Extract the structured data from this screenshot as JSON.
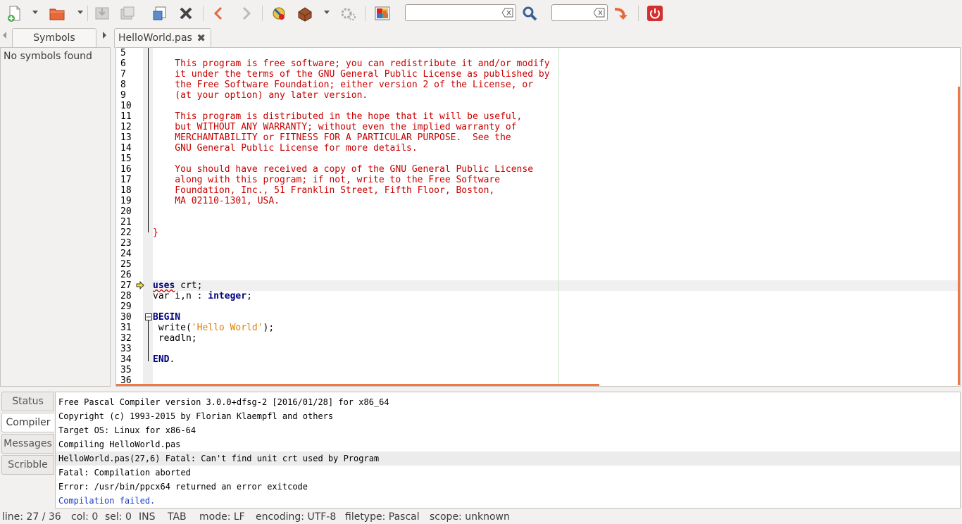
{
  "toolbar": {
    "icons": [
      "new-file-icon",
      "open-file-icon",
      "save-icon",
      "save-all-icon",
      "reload-icon",
      "close-icon",
      "back-icon",
      "forward-icon",
      "compile-icon",
      "build-icon",
      "execute-icon",
      "color-chooser-icon",
      "search-icon",
      "goto-line-icon",
      "quit-icon"
    ]
  },
  "sidebar": {
    "tab_label": "Symbols",
    "empty_text": "No symbols found"
  },
  "editor": {
    "tab_label": "HelloWorld.pas",
    "lines": [
      {
        "n": "5",
        "text": "",
        "cls": "cmt"
      },
      {
        "n": "6",
        "text": "    This program is free software; you can redistribute it and/or modify",
        "cls": "cmt"
      },
      {
        "n": "7",
        "text": "    it under the terms of the GNU General Public License as published by",
        "cls": "cmt"
      },
      {
        "n": "8",
        "text": "    the Free Software Foundation; either version 2 of the License, or",
        "cls": "cmt"
      },
      {
        "n": "9",
        "text": "    (at your option) any later version.",
        "cls": "cmt"
      },
      {
        "n": "10",
        "text": "",
        "cls": "cmt"
      },
      {
        "n": "11",
        "text": "    This program is distributed in the hope that it will be useful,",
        "cls": "cmt"
      },
      {
        "n": "12",
        "text": "    but WITHOUT ANY WARRANTY; without even the implied warranty of",
        "cls": "cmt"
      },
      {
        "n": "13",
        "text": "    MERCHANTABILITY or FITNESS FOR A PARTICULAR PURPOSE.  See the",
        "cls": "cmt"
      },
      {
        "n": "14",
        "text": "    GNU General Public License for more details.",
        "cls": "cmt"
      },
      {
        "n": "15",
        "text": "",
        "cls": "cmt"
      },
      {
        "n": "16",
        "text": "    You should have received a copy of the GNU General Public License",
        "cls": "cmt"
      },
      {
        "n": "17",
        "text": "    along with this program; if not, write to the Free Software",
        "cls": "cmt"
      },
      {
        "n": "18",
        "text": "    Foundation, Inc., 51 Franklin Street, Fifth Floor, Boston,",
        "cls": "cmt"
      },
      {
        "n": "19",
        "text": "    MA 02110-1301, USA.",
        "cls": "cmt"
      },
      {
        "n": "20",
        "text": "",
        "cls": "cmt"
      },
      {
        "n": "21",
        "text": "",
        "cls": "cmt"
      },
      {
        "n": "22",
        "text": "}",
        "cls": "cmt"
      },
      {
        "n": "23",
        "text": "",
        "cls": ""
      },
      {
        "n": "24",
        "text": "",
        "cls": ""
      },
      {
        "n": "25",
        "text": "",
        "cls": ""
      },
      {
        "n": "26",
        "text": "",
        "cls": ""
      },
      {
        "n": "27",
        "text": "",
        "cls": "",
        "html": "uses27"
      },
      {
        "n": "28",
        "text": "",
        "cls": "",
        "html": "var28"
      },
      {
        "n": "29",
        "text": "",
        "cls": ""
      },
      {
        "n": "30",
        "text": "",
        "cls": "",
        "html": "begin30"
      },
      {
        "n": "31",
        "text": "",
        "cls": "",
        "html": "write31"
      },
      {
        "n": "32",
        "text": " readln;",
        "cls": ""
      },
      {
        "n": "33",
        "text": "",
        "cls": ""
      },
      {
        "n": "34",
        "text": "",
        "cls": "",
        "html": "end34"
      },
      {
        "n": "35",
        "text": "",
        "cls": ""
      },
      {
        "n": "36",
        "text": "",
        "cls": ""
      }
    ],
    "tokens": {
      "uses_kw": "uses",
      "uses_rest": " crt;",
      "var_kw": "var",
      "var_mid": " i,n : ",
      "var_type": "integer",
      "var_end": ";",
      "begin_kw": "BEGIN",
      "write_pre": " write(",
      "write_str": "'Hello World'",
      "write_post": ");",
      "end_kw": "END",
      "end_dot": "."
    }
  },
  "bottom": {
    "tabs": [
      "Status",
      "Compiler",
      "Messages",
      "Scribble"
    ],
    "active_tab": "Compiler",
    "messages": [
      "Free Pascal Compiler version 3.0.0+dfsg-2 [2016/01/28] for x86_64",
      "Copyright (c) 1993-2015 by Florian Klaempfl and others",
      "Target OS: Linux for x86-64",
      "Compiling HelloWorld.pas",
      "HelloWorld.pas(27,6) Fatal: Can't find unit crt used by Program",
      "Fatal: Compilation aborted",
      "Error: /usr/bin/ppcx64 returned an error exitcode",
      "Compilation failed."
    ]
  },
  "status": {
    "line": "line: 27 / 36",
    "col": "col: 0",
    "sel": "sel: 0",
    "ins": "INS",
    "tab": "TAB",
    "mode": "mode: LF",
    "encoding": "encoding: UTF-8",
    "filetype": "filetype: Pascal",
    "scope": "scope: unknown"
  },
  "colors": {
    "comment": "#c80000",
    "keyword": "#00007f",
    "string": "#e08000",
    "scroll_marker": "#f07746",
    "link_blue": "#1a3cc8"
  }
}
